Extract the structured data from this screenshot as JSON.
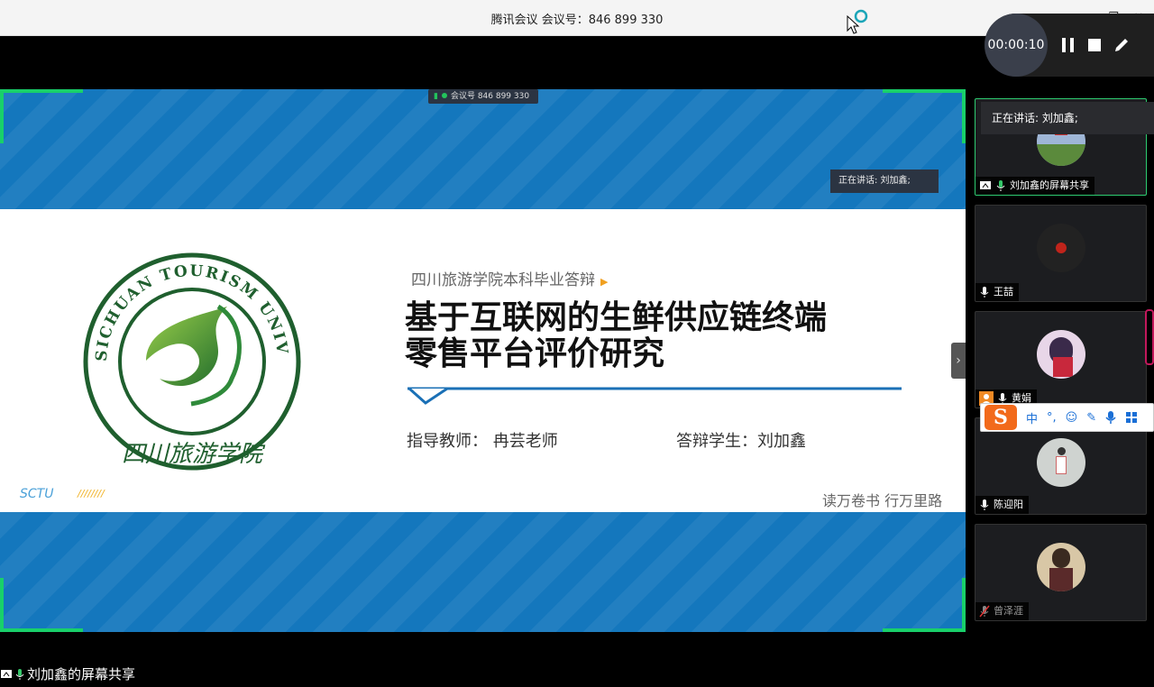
{
  "window": {
    "title": "腾讯会议  会议号：846 899 330"
  },
  "recorder": {
    "time": "00:00:10"
  },
  "share": {
    "meeting_chip": "会议号 846 899 330",
    "speaking_chip": "正在讲话: 刘加鑫;",
    "slide": {
      "subtitle": "四川旅游学院本科毕业答辩",
      "title_line1": "基于互联网的生鲜供应链终端",
      "title_line2": "零售平台评价研究",
      "advisor": "指导教师：  冉芸老师",
      "student": "答辩学生：刘加鑫",
      "logo_ring_text": "SICHUAN TOURISM UNIVERSITY",
      "logo_cn": "四川旅游学院",
      "sctu": "SCTU",
      "slashes": "////////",
      "motto": "读万卷书   行万里路"
    }
  },
  "bottom_label": "刘加鑫的屏幕共享",
  "panel": {
    "speaking_bar": "正在讲话: 刘加鑫;",
    "tiles": [
      {
        "name": "刘加鑫的屏幕共享"
      },
      {
        "name": "王喆"
      },
      {
        "name": "黄娟"
      },
      {
        "name": "陈迎阳"
      },
      {
        "name": "曾泽涯"
      }
    ]
  },
  "ime": {
    "logo": "S",
    "mode": "中",
    "punct": "°,"
  },
  "colors": {
    "accent_green": "#19d06a",
    "band_blue": "#1477bd",
    "ime_orange": "#f26a1b"
  }
}
